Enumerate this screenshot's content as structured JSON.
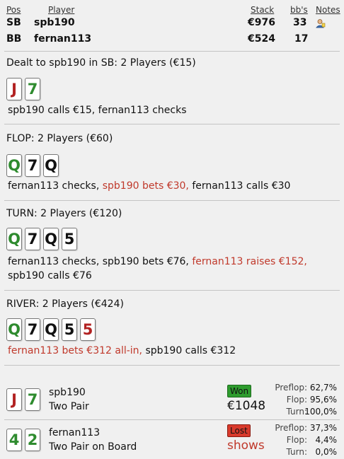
{
  "header": {
    "col_pos": "Pos",
    "col_player": "Player",
    "col_stack": "Stack",
    "col_bbs": "bb's",
    "col_notes": "Notes",
    "players": [
      {
        "pos": "SB",
        "name": "spb190",
        "stack": "€976",
        "bbs": "33"
      },
      {
        "pos": "BB",
        "name": "fernan113",
        "stack": "€524",
        "bbs": "17"
      }
    ]
  },
  "preflop": {
    "title": "Dealt to spb190 in SB: 2 Players (€15)",
    "cards": [
      {
        "rank": "J",
        "suit": "h"
      },
      {
        "rank": "7",
        "suit": "c"
      }
    ],
    "action": "spb190 calls €15, fernan113 checks"
  },
  "flop": {
    "title": "FLOP: 2 Players (€60)",
    "cards": [
      {
        "rank": "Q",
        "suit": "c"
      },
      {
        "rank": "7",
        "suit": "s"
      },
      {
        "rank": "Q",
        "suit": "s"
      }
    ],
    "action_1": "fernan113 checks,",
    "action_2": "spb190 bets €30,",
    "action_3": "fernan113 calls €30"
  },
  "turn": {
    "title": "TURN: 2 Players (€120)",
    "cards": [
      {
        "rank": "Q",
        "suit": "c"
      },
      {
        "rank": "7",
        "suit": "s"
      },
      {
        "rank": "Q",
        "suit": "s"
      },
      {
        "rank": "5",
        "suit": "s"
      }
    ],
    "action_1": "fernan113 checks, spb190 bets €76,",
    "action_2": "fernan113 raises €152,",
    "action_3": "spb190 calls €76"
  },
  "river": {
    "title": "RIVER: 2 Players (€424)",
    "cards": [
      {
        "rank": "Q",
        "suit": "c"
      },
      {
        "rank": "7",
        "suit": "s"
      },
      {
        "rank": "Q",
        "suit": "s"
      },
      {
        "rank": "5",
        "suit": "s"
      },
      {
        "rank": "5",
        "suit": "h"
      }
    ],
    "action_1": "fernan113 bets €312 all-in,",
    "action_2": "spb190 calls €312"
  },
  "showdown": [
    {
      "name": "spb190",
      "hand": "Two Pair",
      "cards": [
        {
          "rank": "J",
          "suit": "h"
        },
        {
          "rank": "7",
          "suit": "c"
        }
      ],
      "result": "Won",
      "amount": "€1048",
      "stats": [
        {
          "label": "Preflop:",
          "value": "62,7%"
        },
        {
          "label": "Flop:",
          "value": "95,6%"
        },
        {
          "label": "Turn:",
          "value": "100,0%"
        }
      ]
    },
    {
      "name": "fernan113",
      "hand": "Two Pair on Board",
      "cards": [
        {
          "rank": "4",
          "suit": "c"
        },
        {
          "rank": "2",
          "suit": "c"
        }
      ],
      "result": "Lost",
      "amount": "shows",
      "stats": [
        {
          "label": "Preflop:",
          "value": "37,3%"
        },
        {
          "label": "Flop:",
          "value": "4,4%"
        },
        {
          "label": "Turn:",
          "value": "0,0%"
        }
      ]
    }
  ],
  "colors": {
    "red_text": "#c0392b",
    "won_badge": "#2e9c2e",
    "lost_badge": "#d83a2c",
    "club": "#2e8b2e",
    "heart": "#b22222"
  },
  "icons": {
    "notes": "user-note-icon"
  }
}
